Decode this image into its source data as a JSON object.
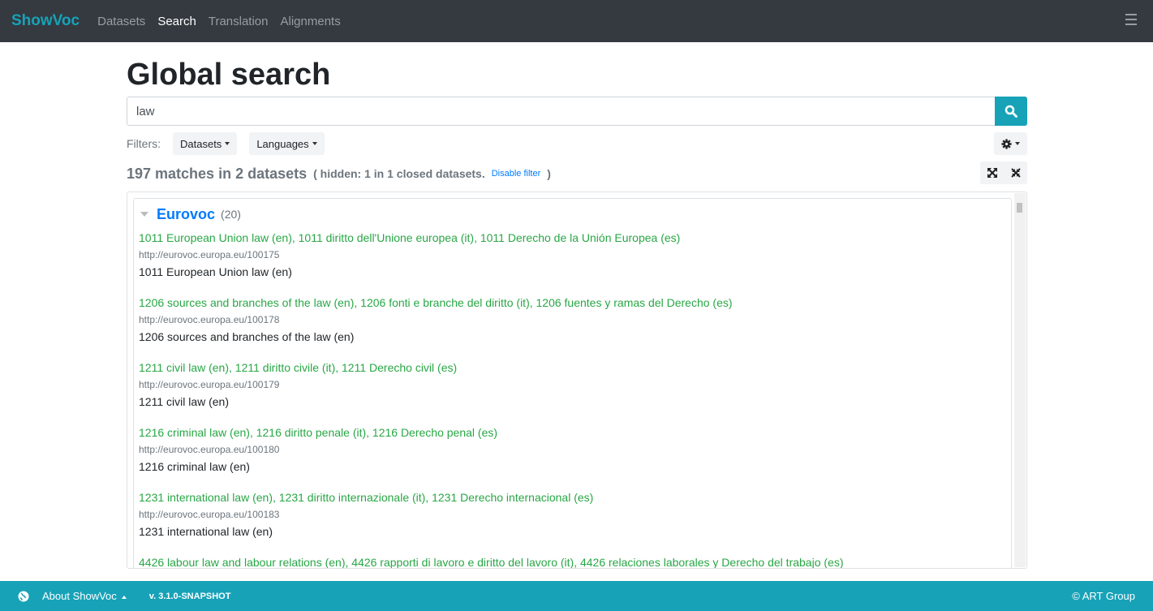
{
  "nav": {
    "brand": "ShowVoc",
    "items": [
      "Datasets",
      "Search",
      "Translation",
      "Alignments"
    ],
    "active": "Search"
  },
  "page": {
    "title": "Global search"
  },
  "search": {
    "value": "law"
  },
  "filters": {
    "label": "Filters:",
    "datasets": "Datasets",
    "languages": "Languages"
  },
  "summary": {
    "count": "197 matches in 2 datasets",
    "hidden": "( hidden: 1 in 1 closed datasets.",
    "disable": "Disable filter",
    "close": ")"
  },
  "dataset": {
    "name": "Eurovoc",
    "count": "(20)"
  },
  "results": [
    {
      "title": "1011 European Union law (en), 1011 diritto dell'Unione europea (it), 1011 Derecho de la Unión Europea (es)",
      "url": "http://eurovoc.europa.eu/100175",
      "label": "1011 European Union law (en)"
    },
    {
      "title": "1206 sources and branches of the law (en), 1206 fonti e branche del diritto (it), 1206 fuentes y ramas del Derecho (es)",
      "url": "http://eurovoc.europa.eu/100178",
      "label": "1206 sources and branches of the law (en)"
    },
    {
      "title": "1211 civil law (en), 1211 diritto civile (it), 1211 Derecho civil (es)",
      "url": "http://eurovoc.europa.eu/100179",
      "label": "1211 civil law (en)"
    },
    {
      "title": "1216 criminal law (en), 1216 diritto penale (it), 1216 Derecho penal (es)",
      "url": "http://eurovoc.europa.eu/100180",
      "label": "1216 criminal law (en)"
    },
    {
      "title": "1231 international law (en), 1231 diritto internazionale (it), 1231 Derecho internacional (es)",
      "url": "http://eurovoc.europa.eu/100183",
      "label": "1231 international law (en)"
    },
    {
      "title": "4426 labour law and labour relations (en), 4426 rapporti di lavoro e diritto del lavoro (it), 4426 relaciones laborales y Derecho del trabajo (es)",
      "url": "",
      "label": ""
    }
  ],
  "footer": {
    "about": "About ShowVoc",
    "version": "v. 3.1.0-SNAPSHOT",
    "copyright": "© ART Group"
  },
  "colors": {
    "navbar": "#343a40",
    "accent": "#17a2b8",
    "result_title": "#28a745",
    "link": "#007bff"
  }
}
